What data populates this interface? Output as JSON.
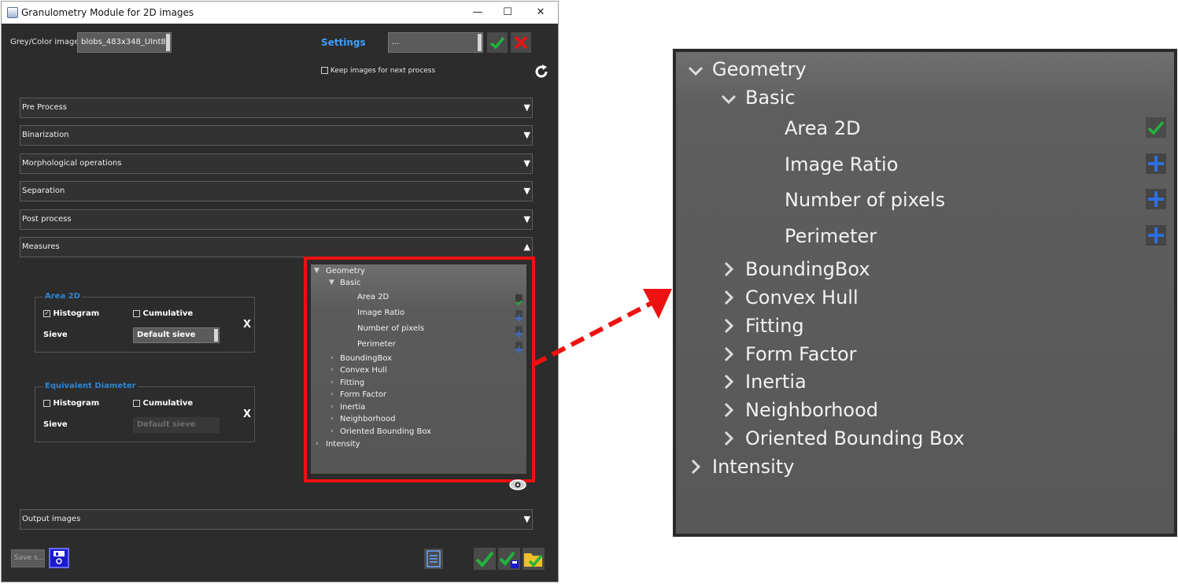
{
  "window": {
    "title": "Granulometry Module for 2D images",
    "controls": {
      "minimize": "—",
      "maximize": "☐",
      "close": "✕"
    }
  },
  "toolbar": {
    "image_label": "Grey/Color image",
    "image_value": "blobs_483x348_UInt8",
    "settings_label": "Settings",
    "settings_value": "...",
    "keep_images_label": "Keep images for next process",
    "keep_images_checked": false
  },
  "sections": [
    {
      "label": "Pre Process",
      "state": "collapsed"
    },
    {
      "label": "Binarization",
      "state": "collapsed"
    },
    {
      "label": "Morphological operations",
      "state": "collapsed"
    },
    {
      "label": "Separation",
      "state": "collapsed"
    },
    {
      "label": "Post process",
      "state": "collapsed"
    },
    {
      "label": "Measures",
      "state": "expanded"
    },
    {
      "label": "Output images",
      "state": "collapsed"
    }
  ],
  "measure_groups": [
    {
      "title": "Area 2D",
      "histogram_label": "Histogram",
      "histogram_checked": true,
      "cumulative_label": "Cumulative",
      "cumulative_checked": false,
      "sieve_label": "Sieve",
      "sieve_value": "Default sieve",
      "sieve_enabled": true,
      "remove": "X"
    },
    {
      "title": "Equivalent Diameter",
      "histogram_label": "Histogram",
      "histogram_checked": false,
      "cumulative_label": "Cumulative",
      "cumulative_checked": false,
      "sieve_label": "Sieve",
      "sieve_value": "Default sieve",
      "sieve_enabled": false,
      "remove": "X"
    }
  ],
  "tree": {
    "geometry": "Geometry",
    "basic": "Basic",
    "basic_items": [
      {
        "label": "Area 2D",
        "status": "selected"
      },
      {
        "label": "Image Ratio",
        "status": "add"
      },
      {
        "label": "Number of pixels",
        "status": "add"
      },
      {
        "label": "Perimeter",
        "status": "add"
      }
    ],
    "geometry_groups": [
      "BoundingBox",
      "Convex Hull",
      "Fitting",
      "Form Factor",
      "Inertia",
      "Neighborhood",
      "Oriented Bounding Box"
    ],
    "intensity": "Intensity"
  },
  "footer": {
    "save_label": "Save s..."
  },
  "colors": {
    "accent_blue": "#3aa0ff",
    "group_title": "#2e86d4",
    "highlight_red": "#ee1111",
    "check_green": "#1fb43a",
    "plus_blue": "#2d6fe0"
  }
}
